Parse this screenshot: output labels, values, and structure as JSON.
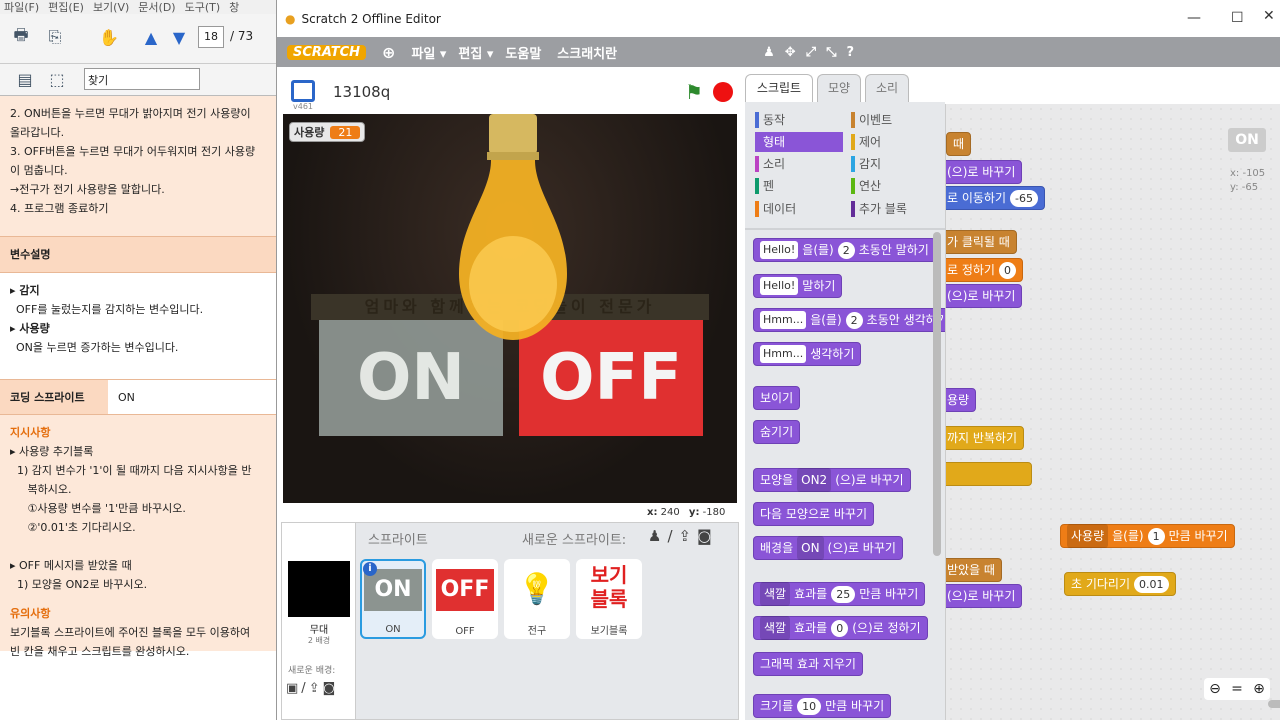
{
  "pdf": {
    "menu": [
      "파일(F)",
      "편집(E)",
      "보기(V)",
      "문서(D)",
      "도구(T)",
      "창"
    ],
    "page_current": "18",
    "page_total": "/ 73",
    "find_placeholder": "찾기",
    "steps": [
      "2.  ON버튼을 누르면 무대가 밝아지며 전기 사용량이",
      "     올라갑니다.",
      "3.  OFF버튼을 누르면 무대가 어두워지며 전기 사용량",
      "     이 멈춥니다.",
      "     →전구가 전기 사용량을 말합니다.",
      "4.  프로그램 종료하기"
    ],
    "var_header": "변수설명",
    "vars": [
      {
        "name": "▸ 감지",
        "desc": "OFF를 눌렀는지를 감지하는 변수입니다."
      },
      {
        "name": "▸ 사용량",
        "desc": "ON을 누르면 증가하는 변수입니다."
      }
    ],
    "sprite_label": "코딩 스프라이트",
    "sprite_value": "ON",
    "instr_title": "지시사항",
    "instr": [
      "▸ 사용량 추기블록",
      "  1) 감지 변수가 '1'이 될 때까지 다음 지시사항을 반",
      "     복하시오.",
      "     ①사용량 변수를 '1'만큼 바꾸시오.",
      "     ②'0.01'초 기다리시오.",
      "",
      "▸ OFF 메시지를 받았을 때",
      "  1) 모양을 ON2로 바꾸시오."
    ],
    "notes_title": "유의사항",
    "notes": [
      "보기블록 스프라이트에 주어진 블록을 모두 이용하여",
      "빈 칸을 채우고 스크립트를 완성하시오."
    ]
  },
  "window": {
    "title": "Scratch 2 Offline Editor"
  },
  "menubar": {
    "logo": "SCRATCH",
    "items": [
      "파일 ▾",
      "편집 ▾",
      "도움말",
      "스크래치란"
    ]
  },
  "stage": {
    "version": "v461",
    "project_name": "13108q",
    "var_name": "사용량",
    "var_value": "21",
    "on_label": "ON",
    "off_label": "OFF",
    "bg_text": "엄마와 함께하는 코딩놀이 전문가",
    "x_label": "x:",
    "x_value": "240",
    "y_label": "y:",
    "y_value": "-180"
  },
  "sprites": {
    "header": "스프라이트",
    "new_sprite": "새로운 스프라이트:",
    "stage_name": "무대",
    "stage_bg": "2 배경",
    "new_bg": "새로운 배경:",
    "items": [
      {
        "name": "ON",
        "thumb": "ON"
      },
      {
        "name": "OFF",
        "thumb": "OFF"
      },
      {
        "name": "전구",
        "thumb": "💡"
      },
      {
        "name": "보기블록",
        "thumb": "보기\n블록"
      }
    ]
  },
  "tabs": [
    "스크립트",
    "모양",
    "소리"
  ],
  "categories_left": [
    "동작",
    "형태",
    "소리",
    "펜",
    "데이터"
  ],
  "categories_right": [
    "이벤트",
    "제어",
    "감지",
    "연산",
    "추가 블록"
  ],
  "category_colors": [
    "#4a6cd4",
    "#8a55d7",
    "#bb42c3",
    "#0e9a6c",
    "#ee7d16",
    "#c88330",
    "#e1a91a",
    "#2ca5e2",
    "#5cb712",
    "#632d99"
  ],
  "palette_blocks": [
    {
      "pre": "Hello!",
      "text": "을(를)",
      "num": "2",
      "post": "초동안 말하기"
    },
    {
      "pre": "Hello!",
      "text": "말하기"
    },
    {
      "pre": "Hmm...",
      "text": "을(를)",
      "num": "2",
      "post": "초동안 생각하기"
    },
    {
      "pre": "Hmm...",
      "text": "생각하기"
    },
    {
      "text": "보이기"
    },
    {
      "text": "숨기기"
    },
    {
      "text": "모양을",
      "drop": "ON2",
      "post": "(으)로 바꾸기"
    },
    {
      "text": "다음 모양으로 바꾸기"
    },
    {
      "text": "배경을",
      "drop": "ON",
      "post": "(으)로 바꾸기"
    },
    {
      "drop": "색깔",
      "text": "효과를",
      "num": "25",
      "post": "만큼 바꾸기"
    },
    {
      "drop": "색깔",
      "text": "효과를",
      "num": "0",
      "post": "(으)로 정하기"
    },
    {
      "text": "그래픽 효과 지우기"
    },
    {
      "text": "크기를",
      "num": "10",
      "post": "만큼 바꾸기"
    }
  ],
  "script": {
    "sprite_name": "ON",
    "x": "x: -105",
    "y": "y: -65",
    "blocks": [
      {
        "text": "때"
      },
      {
        "text": "(으)로 바꾸기"
      },
      {
        "num": "-65",
        "text": "로 이동하기"
      },
      {
        "text": "가 클릭될 때"
      },
      {
        "num": "0",
        "text": "로 정하기"
      },
      {
        "text": "(으)로 바꾸기"
      },
      {
        "text": "용량"
      },
      {
        "text": "까지 반복하기"
      },
      {
        "text": ""
      },
      {
        "drop": "사용량",
        "text": "을(를)",
        "num": "1",
        "post": "만큼 바꾸기"
      },
      {
        "num": "0.01",
        "text": "초 기다리기"
      },
      {
        "text": "받았을 때"
      },
      {
        "text": "(으)로 바꾸기"
      }
    ]
  }
}
